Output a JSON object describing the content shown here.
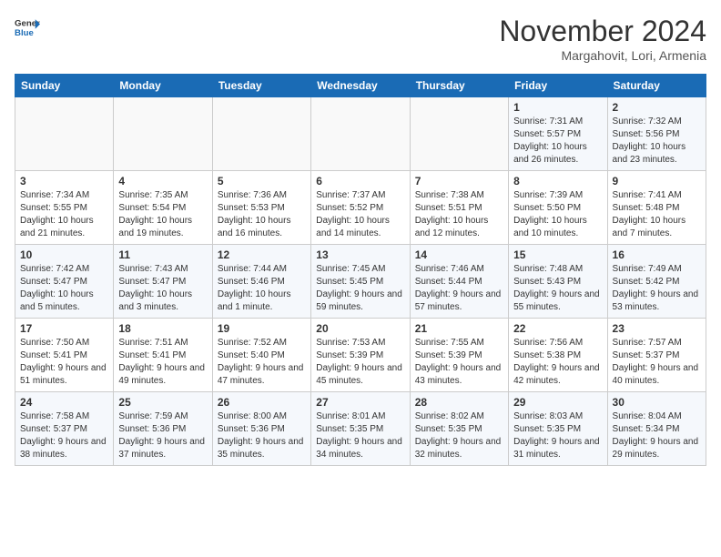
{
  "header": {
    "logo_general": "General",
    "logo_blue": "Blue",
    "month_title": "November 2024",
    "location": "Margahovit, Lori, Armenia"
  },
  "weekdays": [
    "Sunday",
    "Monday",
    "Tuesday",
    "Wednesday",
    "Thursday",
    "Friday",
    "Saturday"
  ],
  "weeks": [
    [
      {
        "day": "",
        "info": ""
      },
      {
        "day": "",
        "info": ""
      },
      {
        "day": "",
        "info": ""
      },
      {
        "day": "",
        "info": ""
      },
      {
        "day": "",
        "info": ""
      },
      {
        "day": "1",
        "info": "Sunrise: 7:31 AM\nSunset: 5:57 PM\nDaylight: 10 hours and 26 minutes."
      },
      {
        "day": "2",
        "info": "Sunrise: 7:32 AM\nSunset: 5:56 PM\nDaylight: 10 hours and 23 minutes."
      }
    ],
    [
      {
        "day": "3",
        "info": "Sunrise: 7:34 AM\nSunset: 5:55 PM\nDaylight: 10 hours and 21 minutes."
      },
      {
        "day": "4",
        "info": "Sunrise: 7:35 AM\nSunset: 5:54 PM\nDaylight: 10 hours and 19 minutes."
      },
      {
        "day": "5",
        "info": "Sunrise: 7:36 AM\nSunset: 5:53 PM\nDaylight: 10 hours and 16 minutes."
      },
      {
        "day": "6",
        "info": "Sunrise: 7:37 AM\nSunset: 5:52 PM\nDaylight: 10 hours and 14 minutes."
      },
      {
        "day": "7",
        "info": "Sunrise: 7:38 AM\nSunset: 5:51 PM\nDaylight: 10 hours and 12 minutes."
      },
      {
        "day": "8",
        "info": "Sunrise: 7:39 AM\nSunset: 5:50 PM\nDaylight: 10 hours and 10 minutes."
      },
      {
        "day": "9",
        "info": "Sunrise: 7:41 AM\nSunset: 5:48 PM\nDaylight: 10 hours and 7 minutes."
      }
    ],
    [
      {
        "day": "10",
        "info": "Sunrise: 7:42 AM\nSunset: 5:47 PM\nDaylight: 10 hours and 5 minutes."
      },
      {
        "day": "11",
        "info": "Sunrise: 7:43 AM\nSunset: 5:47 PM\nDaylight: 10 hours and 3 minutes."
      },
      {
        "day": "12",
        "info": "Sunrise: 7:44 AM\nSunset: 5:46 PM\nDaylight: 10 hours and 1 minute."
      },
      {
        "day": "13",
        "info": "Sunrise: 7:45 AM\nSunset: 5:45 PM\nDaylight: 9 hours and 59 minutes."
      },
      {
        "day": "14",
        "info": "Sunrise: 7:46 AM\nSunset: 5:44 PM\nDaylight: 9 hours and 57 minutes."
      },
      {
        "day": "15",
        "info": "Sunrise: 7:48 AM\nSunset: 5:43 PM\nDaylight: 9 hours and 55 minutes."
      },
      {
        "day": "16",
        "info": "Sunrise: 7:49 AM\nSunset: 5:42 PM\nDaylight: 9 hours and 53 minutes."
      }
    ],
    [
      {
        "day": "17",
        "info": "Sunrise: 7:50 AM\nSunset: 5:41 PM\nDaylight: 9 hours and 51 minutes."
      },
      {
        "day": "18",
        "info": "Sunrise: 7:51 AM\nSunset: 5:41 PM\nDaylight: 9 hours and 49 minutes."
      },
      {
        "day": "19",
        "info": "Sunrise: 7:52 AM\nSunset: 5:40 PM\nDaylight: 9 hours and 47 minutes."
      },
      {
        "day": "20",
        "info": "Sunrise: 7:53 AM\nSunset: 5:39 PM\nDaylight: 9 hours and 45 minutes."
      },
      {
        "day": "21",
        "info": "Sunrise: 7:55 AM\nSunset: 5:39 PM\nDaylight: 9 hours and 43 minutes."
      },
      {
        "day": "22",
        "info": "Sunrise: 7:56 AM\nSunset: 5:38 PM\nDaylight: 9 hours and 42 minutes."
      },
      {
        "day": "23",
        "info": "Sunrise: 7:57 AM\nSunset: 5:37 PM\nDaylight: 9 hours and 40 minutes."
      }
    ],
    [
      {
        "day": "24",
        "info": "Sunrise: 7:58 AM\nSunset: 5:37 PM\nDaylight: 9 hours and 38 minutes."
      },
      {
        "day": "25",
        "info": "Sunrise: 7:59 AM\nSunset: 5:36 PM\nDaylight: 9 hours and 37 minutes."
      },
      {
        "day": "26",
        "info": "Sunrise: 8:00 AM\nSunset: 5:36 PM\nDaylight: 9 hours and 35 minutes."
      },
      {
        "day": "27",
        "info": "Sunrise: 8:01 AM\nSunset: 5:35 PM\nDaylight: 9 hours and 34 minutes."
      },
      {
        "day": "28",
        "info": "Sunrise: 8:02 AM\nSunset: 5:35 PM\nDaylight: 9 hours and 32 minutes."
      },
      {
        "day": "29",
        "info": "Sunrise: 8:03 AM\nSunset: 5:35 PM\nDaylight: 9 hours and 31 minutes."
      },
      {
        "day": "30",
        "info": "Sunrise: 8:04 AM\nSunset: 5:34 PM\nDaylight: 9 hours and 29 minutes."
      }
    ]
  ]
}
